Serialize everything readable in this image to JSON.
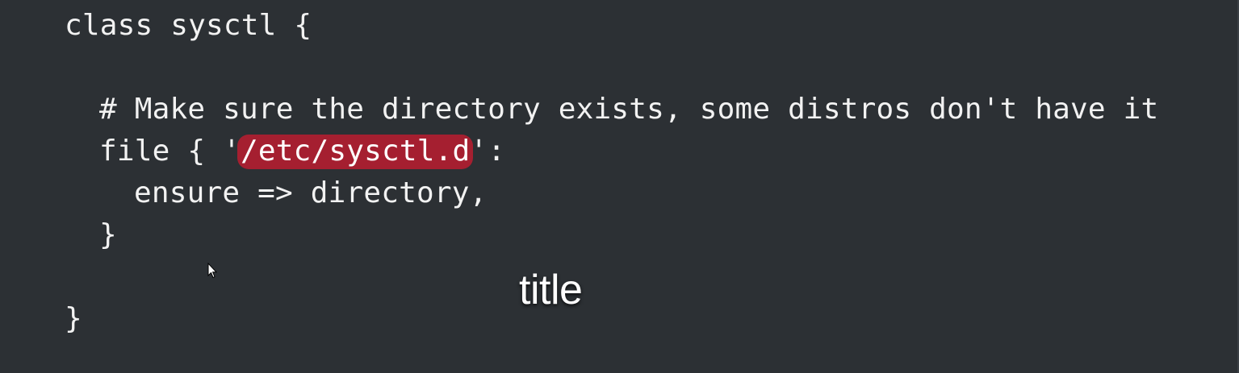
{
  "code": {
    "line1": "class sysctl {",
    "line2": "",
    "line3": "# Make sure the directory exists, some distros don't have it",
    "line4_prefix": "file { '",
    "line4_highlight": "/etc/sysctl.d",
    "line4_suffix": "':",
    "line5": "ensure => directory,",
    "line6": "}",
    "line7": "",
    "line8": "}"
  },
  "caption": {
    "text": "title"
  },
  "colors": {
    "background": "#2c3034",
    "text": "#f2f2f2",
    "highlight": "#a51f30"
  },
  "icons": {
    "cursor": "mouse-pointer-icon"
  }
}
